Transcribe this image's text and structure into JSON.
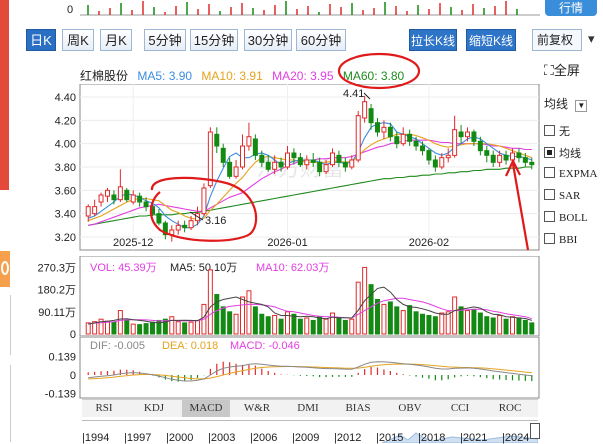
{
  "top_strip": {
    "price_tick": "0",
    "button_label": "行情"
  },
  "toolbar": {
    "periods": [
      "日K",
      "周K",
      "月K",
      "5分钟",
      "15分钟",
      "30分钟",
      "60分钟"
    ],
    "active_period": "日K",
    "stretch_label": "拉长K线",
    "shrink_label": "缩短K线",
    "adjust_label": "前复权"
  },
  "fullscreen_label": "全屏",
  "legend": {
    "stock_name": "红棉股份",
    "ma5": "MA5: 3.90",
    "ma10": "MA10: 3.91",
    "ma20": "MA20: 3.95",
    "ma60": "MA60: 3.80"
  },
  "colors": {
    "ma5": "#3c8de0",
    "ma10": "#e5a31e",
    "ma20": "#e33ee3",
    "ma60": "#1f8a1f",
    "up": "#e12a2a",
    "down": "#138a13",
    "annotation": "#e01a1a",
    "accent": "#2a6fc4"
  },
  "side_panel": {
    "title": "均线",
    "options": [
      {
        "label": "无",
        "checked": false,
        "type": "checkbox"
      },
      {
        "label": "均线",
        "checked": true,
        "type": "checkbox"
      },
      {
        "label": "EXPMA",
        "checked": false,
        "type": "checkbox"
      },
      {
        "label": "SAR",
        "checked": false,
        "type": "checkbox"
      },
      {
        "label": "BOLL",
        "checked": false,
        "type": "checkbox"
      },
      {
        "label": "BBI",
        "checked": false,
        "type": "checkbox"
      }
    ]
  },
  "price_chart": {
    "y_ticks": [
      "4.40",
      "4.20",
      "4.00",
      "3.80",
      "3.60",
      "3.40",
      "3.20"
    ],
    "x_labels": [
      "2025-12",
      "2026-01",
      "2026-02"
    ],
    "high_label": "4.41",
    "low_label": "3.16",
    "watermark": "东方财富"
  },
  "volume_chart": {
    "vol": "VOL: 45.39万",
    "ma5": "MA5: 50.10万",
    "ma10": "MA10: 62.03万",
    "y_ticks": [
      "270.3万",
      "180.2万",
      "90.11万",
      "0"
    ]
  },
  "macd_chart": {
    "dif": "DIF: -0.005",
    "dea": "DEA: 0.018",
    "macd": "MACD: -0.046",
    "y_ticks": [
      "0.139",
      "0",
      "-0.139"
    ]
  },
  "indicator_tabs": [
    "RSI",
    "KDJ",
    "MACD",
    "W&R",
    "DMI",
    "BIAS",
    "OBV",
    "CCI",
    "ROC"
  ],
  "active_indicator": "MACD",
  "timeline_years": [
    "1994",
    "1997",
    "2000",
    "2003",
    "2006",
    "2009",
    "2012",
    "2015",
    "2018",
    "2021",
    "2024"
  ],
  "chart_data": {
    "type": "candlestick",
    "title": "红棉股份",
    "ylim": [
      3.14,
      4.46
    ],
    "x_labels": [
      "2025-12",
      "2026-01",
      "2026-02"
    ],
    "candles": [
      {
        "o": 3.38,
        "c": 3.46,
        "h": 3.48,
        "l": 3.33
      },
      {
        "o": 3.4,
        "c": 3.46,
        "h": 3.52,
        "l": 3.38
      },
      {
        "o": 3.5,
        "c": 3.56,
        "h": 3.58,
        "l": 3.46
      },
      {
        "o": 3.55,
        "c": 3.6,
        "h": 3.62,
        "l": 3.5
      },
      {
        "o": 3.56,
        "c": 3.52,
        "h": 3.6,
        "l": 3.48
      },
      {
        "o": 3.52,
        "c": 3.63,
        "h": 3.78,
        "l": 3.5
      },
      {
        "o": 3.6,
        "c": 3.52,
        "h": 3.62,
        "l": 3.5
      },
      {
        "o": 3.5,
        "c": 3.56,
        "h": 3.6,
        "l": 3.48
      },
      {
        "o": 3.55,
        "c": 3.5,
        "h": 3.58,
        "l": 3.46
      },
      {
        "o": 3.5,
        "c": 3.46,
        "h": 3.54,
        "l": 3.42
      },
      {
        "o": 3.46,
        "c": 3.4,
        "h": 3.5,
        "l": 3.38
      },
      {
        "o": 3.4,
        "c": 3.32,
        "h": 3.44,
        "l": 3.3
      },
      {
        "o": 3.32,
        "c": 3.22,
        "h": 3.34,
        "l": 3.18
      },
      {
        "o": 3.22,
        "c": 3.26,
        "h": 3.3,
        "l": 3.16
      },
      {
        "o": 3.26,
        "c": 3.3,
        "h": 3.34,
        "l": 3.22
      },
      {
        "o": 3.3,
        "c": 3.28,
        "h": 3.34,
        "l": 3.24
      },
      {
        "o": 3.28,
        "c": 3.34,
        "h": 3.38,
        "l": 3.26
      },
      {
        "o": 3.34,
        "c": 3.4,
        "h": 3.46,
        "l": 3.3
      },
      {
        "o": 3.4,
        "c": 3.62,
        "h": 3.66,
        "l": 3.38
      },
      {
        "o": 3.64,
        "c": 4.1,
        "h": 4.14,
        "l": 3.62
      },
      {
        "o": 4.08,
        "c": 3.98,
        "h": 4.14,
        "l": 3.92
      },
      {
        "o": 3.96,
        "c": 3.84,
        "h": 4.0,
        "l": 3.8
      },
      {
        "o": 3.84,
        "c": 3.72,
        "h": 3.88,
        "l": 3.7
      },
      {
        "o": 3.72,
        "c": 3.8,
        "h": 3.86,
        "l": 3.7
      },
      {
        "o": 3.8,
        "c": 3.98,
        "h": 4.08,
        "l": 3.78
      },
      {
        "o": 3.98,
        "c": 4.06,
        "h": 4.18,
        "l": 3.94
      },
      {
        "o": 4.04,
        "c": 3.9,
        "h": 4.08,
        "l": 3.86
      },
      {
        "o": 3.9,
        "c": 3.84,
        "h": 3.94,
        "l": 3.8
      },
      {
        "o": 3.84,
        "c": 3.78,
        "h": 3.9,
        "l": 3.76
      },
      {
        "o": 3.78,
        "c": 3.84,
        "h": 3.9,
        "l": 3.74
      },
      {
        "o": 3.84,
        "c": 3.8,
        "h": 3.88,
        "l": 3.76
      },
      {
        "o": 3.8,
        "c": 3.92,
        "h": 3.98,
        "l": 3.78
      },
      {
        "o": 3.92,
        "c": 3.88,
        "h": 3.96,
        "l": 3.82
      },
      {
        "o": 3.88,
        "c": 3.82,
        "h": 3.92,
        "l": 3.8
      },
      {
        "o": 3.82,
        "c": 3.86,
        "h": 3.9,
        "l": 3.78
      },
      {
        "o": 3.86,
        "c": 3.84,
        "h": 3.92,
        "l": 3.8
      },
      {
        "o": 3.84,
        "c": 3.76,
        "h": 3.88,
        "l": 3.72
      },
      {
        "o": 3.76,
        "c": 3.82,
        "h": 3.86,
        "l": 3.74
      },
      {
        "o": 3.82,
        "c": 3.92,
        "h": 3.96,
        "l": 3.8
      },
      {
        "o": 3.9,
        "c": 3.84,
        "h": 3.94,
        "l": 3.8
      },
      {
        "o": 3.84,
        "c": 3.8,
        "h": 3.88,
        "l": 3.76
      },
      {
        "o": 3.8,
        "c": 3.86,
        "h": 3.9,
        "l": 3.78
      },
      {
        "o": 3.86,
        "c": 4.24,
        "h": 4.28,
        "l": 3.84
      },
      {
        "o": 4.22,
        "c": 4.36,
        "h": 4.41,
        "l": 4.18
      },
      {
        "o": 4.3,
        "c": 4.18,
        "h": 4.34,
        "l": 4.12
      },
      {
        "o": 4.18,
        "c": 4.1,
        "h": 4.22,
        "l": 4.06
      },
      {
        "o": 4.1,
        "c": 4.14,
        "h": 4.2,
        "l": 4.04
      },
      {
        "o": 4.14,
        "c": 4.06,
        "h": 4.18,
        "l": 4.02
      },
      {
        "o": 4.06,
        "c": 4.0,
        "h": 4.1,
        "l": 3.96
      },
      {
        "o": 4.0,
        "c": 4.08,
        "h": 4.14,
        "l": 3.98
      },
      {
        "o": 4.08,
        "c": 4.02,
        "h": 4.12,
        "l": 3.98
      },
      {
        "o": 4.02,
        "c": 3.98,
        "h": 4.06,
        "l": 3.94
      },
      {
        "o": 3.98,
        "c": 3.94,
        "h": 4.02,
        "l": 3.9
      },
      {
        "o": 3.94,
        "c": 3.86,
        "h": 3.96,
        "l": 3.82
      },
      {
        "o": 3.86,
        "c": 3.8,
        "h": 3.9,
        "l": 3.76
      },
      {
        "o": 3.8,
        "c": 3.88,
        "h": 3.92,
        "l": 3.78
      },
      {
        "o": 3.88,
        "c": 3.9,
        "h": 3.96,
        "l": 3.84
      },
      {
        "o": 3.9,
        "c": 4.12,
        "h": 4.24,
        "l": 3.88
      },
      {
        "o": 4.1,
        "c": 4.06,
        "h": 4.16,
        "l": 4.0
      },
      {
        "o": 4.06,
        "c": 4.1,
        "h": 4.14,
        "l": 4.02
      },
      {
        "o": 4.1,
        "c": 4.02,
        "h": 4.12,
        "l": 3.98
      },
      {
        "o": 4.02,
        "c": 3.94,
        "h": 4.06,
        "l": 3.9
      },
      {
        "o": 3.94,
        "c": 3.9,
        "h": 3.98,
        "l": 3.84
      },
      {
        "o": 3.9,
        "c": 3.84,
        "h": 3.94,
        "l": 3.8
      },
      {
        "o": 3.84,
        "c": 3.9,
        "h": 3.94,
        "l": 3.8
      },
      {
        "o": 3.9,
        "c": 3.86,
        "h": 3.94,
        "l": 3.82
      },
      {
        "o": 3.86,
        "c": 3.92,
        "h": 3.96,
        "l": 3.84
      },
      {
        "o": 3.92,
        "c": 3.88,
        "h": 3.96,
        "l": 3.84
      },
      {
        "o": 3.88,
        "c": 3.84,
        "h": 3.92,
        "l": 3.8
      },
      {
        "o": 3.84,
        "c": 3.82,
        "h": 3.88,
        "l": 3.78
      }
    ],
    "ma5": [
      3.36,
      3.38,
      3.42,
      3.46,
      3.5,
      3.55,
      3.57,
      3.56,
      3.54,
      3.51,
      3.49,
      3.45,
      3.38,
      3.34,
      3.31,
      3.28,
      3.28,
      3.31,
      3.38,
      3.55,
      3.68,
      3.79,
      3.89,
      3.92,
      3.88,
      3.88,
      3.91,
      3.92,
      3.9,
      3.86,
      3.82,
      3.83,
      3.85,
      3.86,
      3.86,
      3.86,
      3.84,
      3.82,
      3.84,
      3.84,
      3.83,
      3.84,
      3.93,
      4.05,
      4.14,
      4.17,
      4.18,
      4.17,
      4.1,
      4.08,
      4.06,
      4.04,
      4.0,
      3.96,
      3.92,
      3.9,
      3.92,
      3.97,
      4.0,
      4.04,
      4.06,
      4.04,
      4.0,
      3.96,
      3.92,
      3.9,
      3.89,
      3.89,
      3.88,
      3.86
    ],
    "ma10": [
      3.34,
      3.36,
      3.38,
      3.41,
      3.44,
      3.47,
      3.5,
      3.52,
      3.53,
      3.53,
      3.52,
      3.51,
      3.47,
      3.43,
      3.41,
      3.38,
      3.36,
      3.35,
      3.36,
      3.43,
      3.48,
      3.54,
      3.6,
      3.66,
      3.71,
      3.78,
      3.84,
      3.88,
      3.89,
      3.88,
      3.87,
      3.86,
      3.86,
      3.85,
      3.84,
      3.84,
      3.84,
      3.84,
      3.85,
      3.85,
      3.84,
      3.85,
      3.89,
      3.95,
      3.99,
      4.02,
      4.04,
      4.06,
      4.08,
      4.08,
      4.08,
      4.07,
      4.05,
      4.03,
      4.0,
      3.98,
      3.97,
      3.98,
      3.99,
      4.0,
      4.0,
      4.0,
      4.0,
      3.99,
      3.98,
      3.96,
      3.94,
      3.92,
      3.9,
      3.88
    ],
    "ma20": [
      3.3,
      3.31,
      3.33,
      3.35,
      3.37,
      3.39,
      3.41,
      3.43,
      3.45,
      3.46,
      3.47,
      3.48,
      3.47,
      3.46,
      3.45,
      3.44,
      3.43,
      3.42,
      3.42,
      3.45,
      3.48,
      3.51,
      3.54,
      3.56,
      3.58,
      3.62,
      3.66,
      3.7,
      3.73,
      3.76,
      3.78,
      3.81,
      3.83,
      3.85,
      3.86,
      3.86,
      3.87,
      3.87,
      3.88,
      3.88,
      3.88,
      3.89,
      3.91,
      3.93,
      3.95,
      3.97,
      3.98,
      4.0,
      4.01,
      4.02,
      4.03,
      4.03,
      4.03,
      4.03,
      4.02,
      4.01,
      4.01,
      4.0,
      4.0,
      4.0,
      4.0,
      4.0,
      3.99,
      3.98,
      3.98,
      3.97,
      3.96,
      3.96,
      3.95,
      3.95
    ],
    "ma60": [
      3.3,
      3.31,
      3.32,
      3.33,
      3.34,
      3.35,
      3.36,
      3.37,
      3.38,
      3.38,
      3.39,
      3.39,
      3.39,
      3.39,
      3.4,
      3.4,
      3.41,
      3.41,
      3.42,
      3.43,
      3.44,
      3.45,
      3.46,
      3.47,
      3.48,
      3.49,
      3.5,
      3.51,
      3.52,
      3.53,
      3.54,
      3.55,
      3.56,
      3.57,
      3.58,
      3.59,
      3.6,
      3.61,
      3.62,
      3.63,
      3.64,
      3.65,
      3.66,
      3.67,
      3.68,
      3.69,
      3.7,
      3.7,
      3.71,
      3.71,
      3.72,
      3.72,
      3.73,
      3.73,
      3.74,
      3.74,
      3.75,
      3.75,
      3.76,
      3.76,
      3.77,
      3.77,
      3.78,
      3.78,
      3.78,
      3.79,
      3.79,
      3.79,
      3.8,
      3.8
    ],
    "volume": {
      "ylim": [
        0,
        300
      ],
      "values": [
        45,
        50,
        60,
        52,
        48,
        95,
        55,
        40,
        38,
        42,
        48,
        55,
        60,
        70,
        50,
        45,
        48,
        55,
        120,
        260,
        160,
        110,
        90,
        80,
        150,
        175,
        110,
        80,
        70,
        75,
        60,
        90,
        80,
        60,
        65,
        55,
        70,
        60,
        85,
        65,
        55,
        60,
        210,
        270,
        200,
        140,
        120,
        130,
        110,
        95,
        115,
        90,
        80,
        75,
        70,
        85,
        90,
        150,
        110,
        95,
        100,
        85,
        70,
        65,
        75,
        60,
        70,
        65,
        55,
        45
      ],
      "ma5": [
        40,
        45,
        50,
        52,
        55,
        61,
        62,
        58,
        55,
        52,
        47,
        45,
        49,
        55,
        55,
        56,
        55,
        54,
        68,
        110,
        130,
        140,
        145,
        150,
        140,
        130,
        125,
        120,
        110,
        85,
        75,
        75,
        72,
        70,
        72,
        70,
        65,
        62,
        68,
        66,
        66,
        65,
        96,
        135,
        160,
        185,
        190,
        170,
        140,
        120,
        110,
        108,
        102,
        95,
        85,
        80,
        80,
        95,
        100,
        105,
        110,
        105,
        90,
        80,
        78,
        70,
        68,
        65,
        63,
        55
      ],
      "ma10": [
        42,
        44,
        46,
        48,
        50,
        55,
        57,
        58,
        58,
        57,
        55,
        53,
        54,
        55,
        54,
        53,
        53,
        54,
        60,
        80,
        95,
        105,
        112,
        115,
        118,
        120,
        120,
        118,
        115,
        110,
        100,
        92,
        90,
        85,
        80,
        75,
        72,
        70,
        70,
        68,
        66,
        65,
        80,
        95,
        110,
        125,
        135,
        140,
        145,
        145,
        140,
        135,
        130,
        122,
        112,
        102,
        95,
        95,
        96,
        98,
        100,
        100,
        98,
        92,
        88,
        82,
        78,
        74,
        70,
        62
      ]
    },
    "macd": {
      "ylim": [
        -0.15,
        0.15
      ],
      "dif": [
        -0.02,
        -0.015,
        -0.01,
        -0.005,
        0.0,
        0.01,
        0.015,
        0.018,
        0.015,
        0.01,
        0.002,
        -0.008,
        -0.02,
        -0.032,
        -0.04,
        -0.045,
        -0.045,
        -0.04,
        -0.03,
        0.0,
        0.03,
        0.05,
        0.06,
        0.065,
        0.07,
        0.08,
        0.085,
        0.08,
        0.075,
        0.07,
        0.065,
        0.065,
        0.063,
        0.06,
        0.058,
        0.055,
        0.05,
        0.048,
        0.048,
        0.046,
        0.044,
        0.043,
        0.06,
        0.08,
        0.095,
        0.1,
        0.098,
        0.095,
        0.09,
        0.085,
        0.08,
        0.075,
        0.068,
        0.06,
        0.05,
        0.045,
        0.045,
        0.05,
        0.052,
        0.053,
        0.05,
        0.045,
        0.038,
        0.03,
        0.025,
        0.018,
        0.012,
        0.006,
        0.0,
        -0.005
      ],
      "dea": [
        -0.03,
        -0.027,
        -0.024,
        -0.02,
        -0.016,
        -0.01,
        -0.005,
        0.0,
        0.003,
        0.004,
        0.004,
        0.001,
        -0.003,
        -0.009,
        -0.015,
        -0.021,
        -0.026,
        -0.029,
        -0.029,
        -0.023,
        -0.012,
        0.0,
        0.012,
        0.023,
        0.032,
        0.042,
        0.05,
        0.056,
        0.06,
        0.062,
        0.063,
        0.064,
        0.064,
        0.063,
        0.062,
        0.06,
        0.058,
        0.056,
        0.055,
        0.053,
        0.051,
        0.05,
        0.052,
        0.058,
        0.065,
        0.072,
        0.077,
        0.08,
        0.082,
        0.082,
        0.082,
        0.081,
        0.078,
        0.074,
        0.07,
        0.065,
        0.061,
        0.059,
        0.057,
        0.056,
        0.055,
        0.053,
        0.05,
        0.046,
        0.042,
        0.037,
        0.032,
        0.027,
        0.022,
        0.018
      ],
      "hist": [
        0.02,
        0.024,
        0.028,
        0.03,
        0.032,
        0.04,
        0.04,
        0.036,
        0.024,
        0.012,
        -0.004,
        -0.018,
        -0.034,
        -0.046,
        -0.05,
        -0.048,
        -0.038,
        -0.022,
        -0.002,
        0.046,
        0.084,
        0.1,
        0.096,
        0.084,
        0.076,
        0.076,
        0.07,
        0.048,
        0.03,
        0.016,
        0.004,
        0.002,
        -0.002,
        -0.006,
        -0.008,
        -0.01,
        -0.016,
        -0.016,
        -0.014,
        -0.014,
        -0.014,
        -0.014,
        0.016,
        0.044,
        0.06,
        0.056,
        0.042,
        0.03,
        0.016,
        0.006,
        -0.004,
        -0.012,
        -0.02,
        -0.028,
        -0.04,
        -0.04,
        -0.032,
        -0.018,
        -0.01,
        -0.006,
        -0.01,
        -0.016,
        -0.024,
        -0.032,
        -0.034,
        -0.038,
        -0.04,
        -0.042,
        -0.044,
        -0.046
      ]
    }
  }
}
